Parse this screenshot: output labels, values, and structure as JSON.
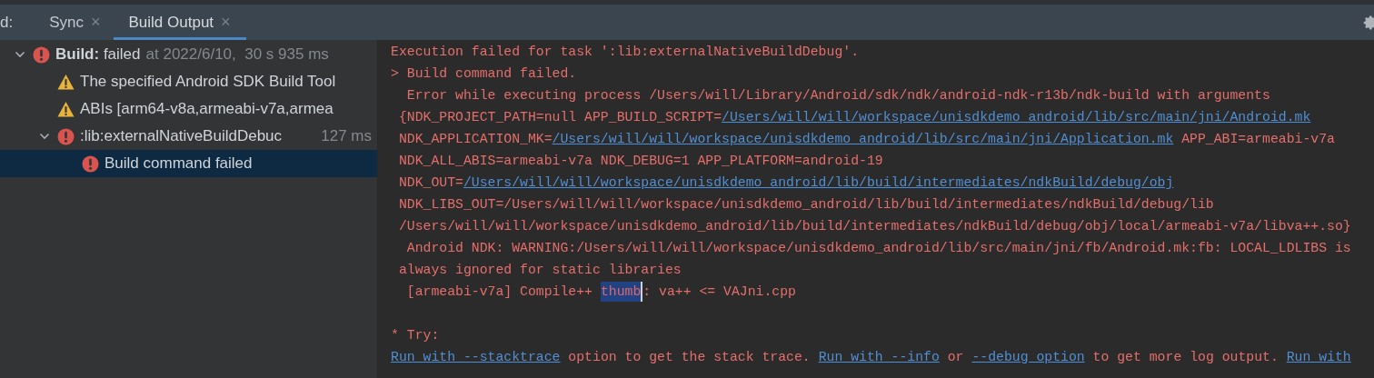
{
  "tab_bar": {
    "prefix": "d:",
    "tabs": [
      {
        "label": "Sync",
        "close": "×",
        "selected": false
      },
      {
        "label": "Build Output",
        "close": "×",
        "selected": true
      }
    ]
  },
  "tree": [
    {
      "kind": "error",
      "label": "**Build:** failed",
      "detail": "at 2022/6/10,  30 s 935 ms",
      "expanded": true,
      "selected": false,
      "children": [
        {
          "kind": "warning",
          "label": "The specified Android SDK Build Tool",
          "selected": false
        },
        {
          "kind": "warning",
          "label": "ABIs [arm64-v8a,armeabi-v7a,armea",
          "selected": false
        },
        {
          "kind": "error",
          "label": ":lib:externalNativeBuildDebuc",
          "time": "127 ms",
          "expanded": true,
          "selected": false,
          "children": [
            {
              "kind": "error",
              "label": "Build command failed",
              "selected": true
            }
          ]
        }
      ]
    }
  ],
  "output": [
    [
      {
        "kind": "text",
        "text": "Execution failed for task ':lib:externalNativeBuildDebug'."
      }
    ],
    [
      {
        "kind": "text",
        "text": "> Build command failed."
      }
    ],
    [
      {
        "kind": "text",
        "text": "  Error while executing process /Users/will/Library/Android/sdk/ndk/android-ndk-r13b/ndk-build with arguments"
      }
    ],
    [
      {
        "kind": "text",
        "text": " {NDK_PROJECT_PATH=null APP_BUILD_SCRIPT="
      },
      {
        "kind": "link",
        "text": "/Users/will/will/workspace/unisdkdemo_android/lib/src/main/jni/Android.mk"
      }
    ],
    [
      {
        "kind": "text",
        "text": " NDK_APPLICATION_MK="
      },
      {
        "kind": "link",
        "text": "/Users/will/will/workspace/unisdkdemo_android/lib/src/main/jni/Application.mk"
      },
      {
        "kind": "text",
        "text": " APP_ABI=armeabi-v7a"
      }
    ],
    [
      {
        "kind": "text",
        "text": " NDK_ALL_ABIS=armeabi-v7a NDK_DEBUG=1 APP_PLATFORM=android-19"
      }
    ],
    [
      {
        "kind": "text",
        "text": " NDK_OUT="
      },
      {
        "kind": "link",
        "text": "/Users/will/will/workspace/unisdkdemo_android/lib/build/intermediates/ndkBuild/debug/obj"
      }
    ],
    [
      {
        "kind": "text",
        "text": " NDK_LIBS_OUT=/Users/will/will/workspace/unisdkdemo_android/lib/build/intermediates/ndkBuild/debug/lib"
      }
    ],
    [
      {
        "kind": "text",
        "text": " /Users/will/will/workspace/unisdkdemo_android/lib/build/intermediates/ndkBuild/debug/obj/local/armeabi-v7a/libva++.so}"
      }
    ],
    [
      {
        "kind": "text",
        "text": "  Android NDK: WARNING:/Users/will/will/workspace/unisdkdemo_android/lib/src/main/jni/fb/Android.mk:fb: LOCAL_LDLIBS is"
      }
    ],
    [
      {
        "kind": "text",
        "text": " always ignored for static libraries"
      }
    ],
    [
      {
        "kind": "text",
        "text": "  [armeabi-v7a] Compile++ "
      },
      {
        "kind": "selected",
        "text": "thumb"
      },
      {
        "kind": "text",
        "text": ": va++ <= VAJni.cpp"
      }
    ],
    {
      "gap_before": true,
      "segments": [
        {
          "kind": "text",
          "text": "* Try:"
        }
      ]
    },
    [
      {
        "kind": "link",
        "text": "Run with --stacktrace"
      },
      {
        "kind": "text",
        "text": " option to get the stack trace. "
      },
      {
        "kind": "link",
        "text": "Run with --info"
      },
      {
        "kind": "text",
        "text": " or "
      },
      {
        "kind": "link",
        "text": "--debug option"
      },
      {
        "kind": "text",
        "text": " to get more log output. "
      },
      {
        "kind": "link",
        "text": "Run with"
      }
    ]
  ]
}
